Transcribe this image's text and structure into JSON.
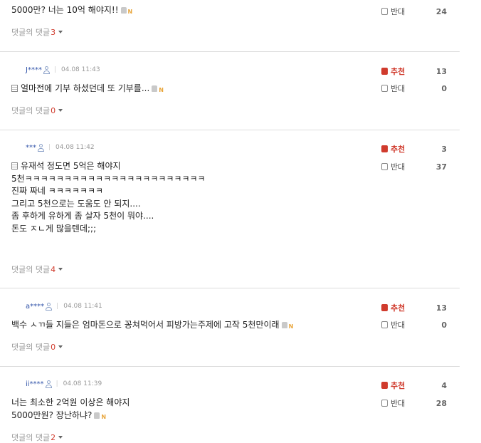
{
  "labels": {
    "recommend": "추천",
    "oppose": "반대",
    "reply_label": "댓글의 댓글"
  },
  "comments": [
    {
      "user": "",
      "date": "",
      "lines": [
        "5000만? 너는 10억 해야지!!"
      ],
      "recommend": "",
      "oppose": "24",
      "replies": "3"
    },
    {
      "user": "J****",
      "date": "04.08 11:43",
      "lines": [
        "얼마전에 기부 하셨던데 또 기부를..."
      ],
      "recommend": "13",
      "oppose": "0",
      "replies": "0"
    },
    {
      "user": "***",
      "date": "04.08 11:42",
      "lines": [
        "유재석 정도면 5억은 해야지",
        "5천ㅋㅋㅋㅋㅋㅋㅋㅋㅋㅋㅋㅋㅋㅋㅋㅋㅋㅋㅋㅋㅋㅋㅋ",
        "진짜 짜네 ㅋㅋㅋㅋㅋㅋㅋ",
        "그리고 5천으로는 도움도 안 되지....",
        "좀 후하게 유하게 좀 살자 5천이 뭐야....",
        "돈도 ㅈㄴ게 많을텐데;;;"
      ],
      "recommend": "3",
      "oppose": "37",
      "replies": "4"
    },
    {
      "user": "a****",
      "date": "04.08 11:41",
      "lines": [
        "백수 ㅅㄲ들 지들은 엄마돈으로 꽁쳐먹어서 피방가는주제에 고작 5천만이래"
      ],
      "recommend": "13",
      "oppose": "0",
      "replies": "0"
    },
    {
      "user": "ii****",
      "date": "04.08 11:39",
      "lines": [
        "너는 최소한 2억원 이상은 해야지",
        "5000만원? 장난하냐?"
      ],
      "recommend": "4",
      "oppose": "28",
      "replies": "2"
    }
  ]
}
